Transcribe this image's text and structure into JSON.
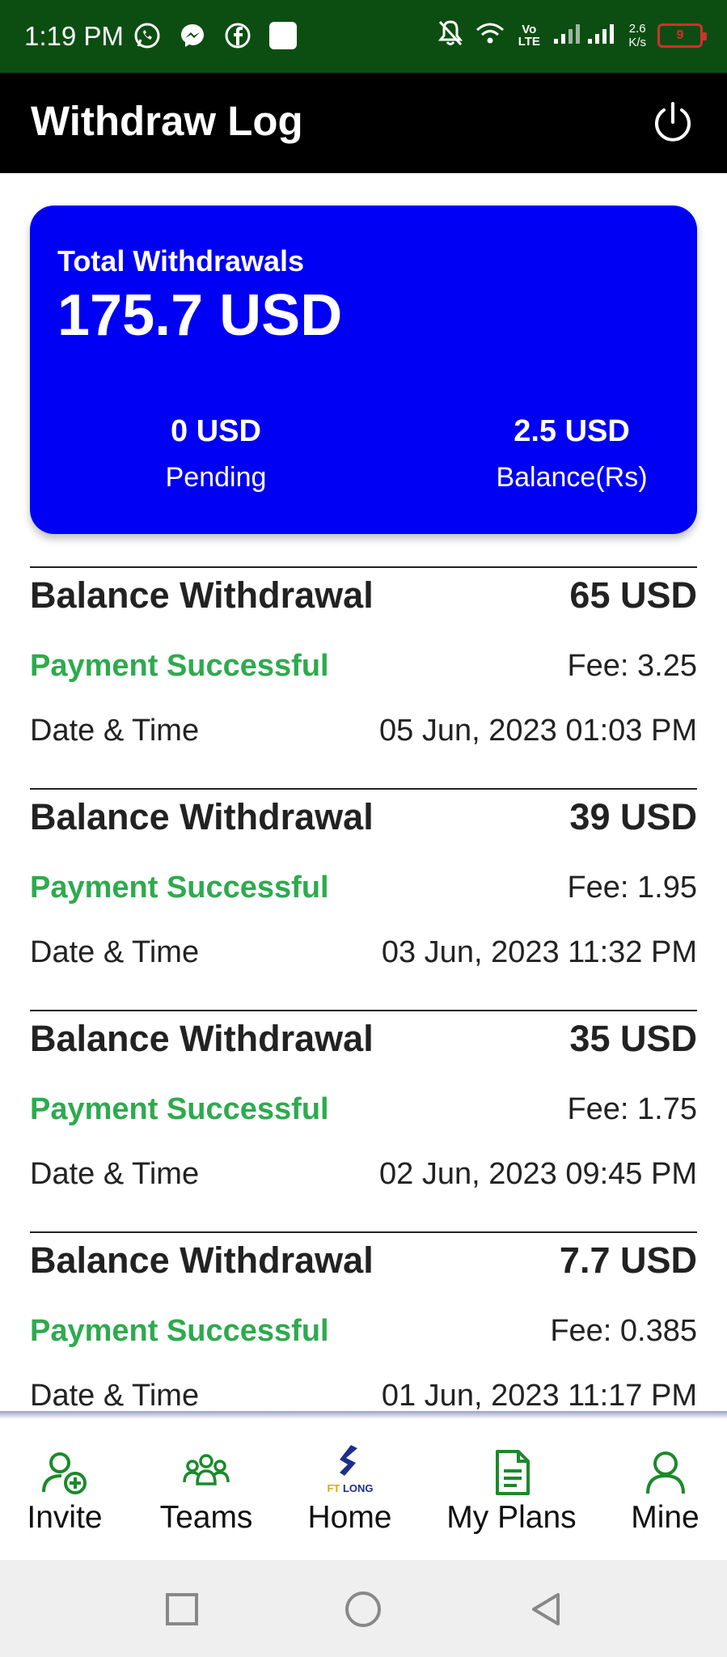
{
  "status_bar": {
    "time": "1:19 PM",
    "speed_value": "2.6",
    "speed_unit": "K/s",
    "battery_level": "9",
    "network_label": "Vo LTE",
    "icons": [
      "whatsapp-icon",
      "messenger-icon",
      "facebook-icon",
      "square-notification-icon",
      "mute-icon",
      "wifi-icon",
      "signal-icon",
      "battery-icon"
    ]
  },
  "header": {
    "title": "Withdraw Log",
    "power_icon": "power-icon"
  },
  "summary": {
    "total_label": "Total Withdrawals",
    "total_value": "175.7 USD",
    "pending_value": "0 USD",
    "pending_label": "Pending",
    "balance_value": "2.5 USD",
    "balance_label": "Balance(Rs)"
  },
  "withdrawals": [
    {
      "title": "Balance Withdrawal",
      "amount": "65 USD",
      "status": "Payment Successful",
      "fee": "Fee: 3.25",
      "datetime_label": "Date & Time",
      "datetime": "05 Jun, 2023 01:03 PM"
    },
    {
      "title": "Balance Withdrawal",
      "amount": "39 USD",
      "status": "Payment Successful",
      "fee": "Fee: 1.95",
      "datetime_label": "Date & Time",
      "datetime": "03 Jun, 2023 11:32 PM"
    },
    {
      "title": "Balance Withdrawal",
      "amount": "35 USD",
      "status": "Payment Successful",
      "fee": "Fee: 1.75",
      "datetime_label": "Date & Time",
      "datetime": "02 Jun, 2023 09:45 PM"
    },
    {
      "title": "Balance Withdrawal",
      "amount": "7.7 USD",
      "status": "Payment Successful",
      "fee": "Fee: 0.385",
      "datetime_label": "Date & Time",
      "datetime": "01 Jun, 2023 11:17 PM"
    }
  ],
  "bottom_nav": {
    "logo_text": "FT LONG",
    "items": [
      {
        "label": "Invite",
        "icon": "add-user-icon"
      },
      {
        "label": "Teams",
        "icon": "teams-icon"
      },
      {
        "label": "Home",
        "icon": "ftlong-logo-icon"
      },
      {
        "label": "My Plans",
        "icon": "document-icon"
      },
      {
        "label": "Mine",
        "icon": "user-icon"
      }
    ]
  },
  "colors": {
    "status_bar": "#0c4e12",
    "app_bar": "#000000",
    "summary_card": "#0000f5",
    "success_green": "#2eaa4e",
    "nav_green": "#1a8a2a"
  }
}
